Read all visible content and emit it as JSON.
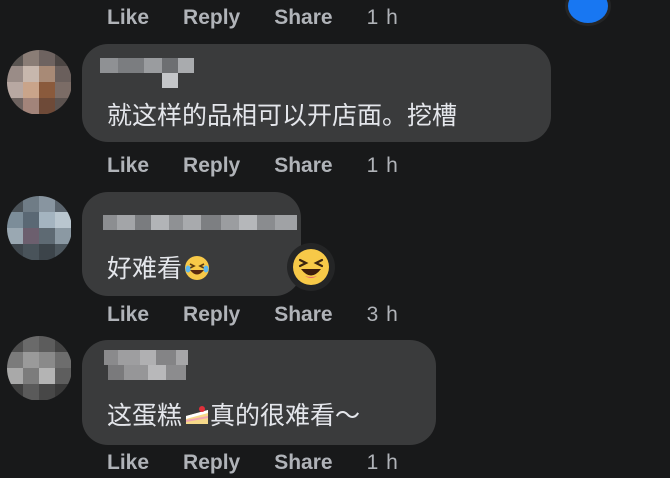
{
  "actions": {
    "like": "Like",
    "reply": "Reply",
    "share": "Share"
  },
  "comments": [
    {
      "text": "就这样的品相可以开店面。挖槽",
      "time": "1 h"
    },
    {
      "text": "好难看",
      "time": "3 h"
    },
    {
      "text": "这蛋糕",
      "text_after": "真的很难看～",
      "time": "1 h"
    }
  ],
  "top_time": "1 h",
  "colors": {
    "background": "#18191a",
    "bubble": "#3a3b3c",
    "action_text": "#b0b3b8",
    "accent": "#1877f2"
  }
}
